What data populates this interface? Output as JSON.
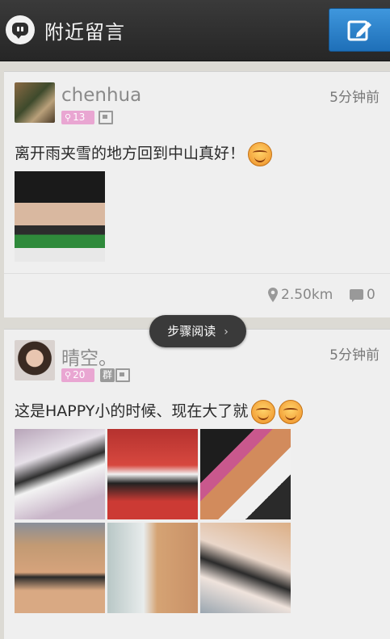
{
  "header": {
    "title": "附近留言",
    "logo_icon": "chat-bubble-icon",
    "compose_icon": "edit-icon",
    "accent_color": "#2f86d0"
  },
  "posts": [
    {
      "username": "chenhua",
      "time": "5分钟前",
      "level": "13",
      "text": "离开雨夹雪的地方回到中山真好！",
      "distance": "2.50km",
      "comments": "0"
    },
    {
      "username": "晴空。",
      "time": "5分钟前",
      "level": "20",
      "group_tag": "群",
      "text": "这是HAPPY小的时候、现在大了就"
    }
  ],
  "floating_button": {
    "label": "步骤阅读",
    "chevron": "›"
  },
  "colors": {
    "level_badge": "#e9a6d2",
    "card_bg": "#efefef",
    "header_bg": "#2e2e2e"
  }
}
